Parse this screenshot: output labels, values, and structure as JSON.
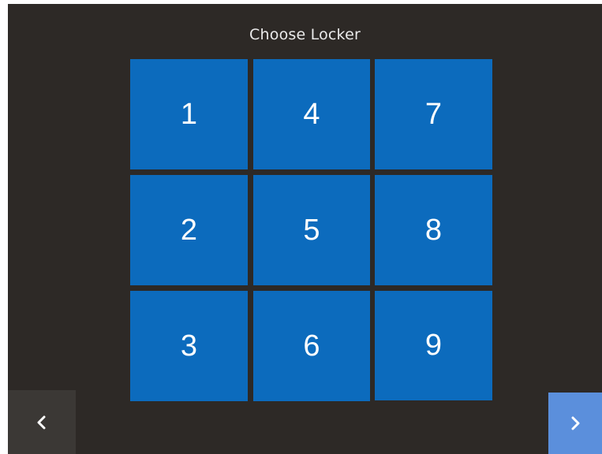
{
  "screen": {
    "title": "Choose Locker"
  },
  "lockers": [
    {
      "number": "1"
    },
    {
      "number": "2"
    },
    {
      "number": "3"
    },
    {
      "number": "4"
    },
    {
      "number": "5"
    },
    {
      "number": "6"
    },
    {
      "number": "7"
    },
    {
      "number": "8"
    },
    {
      "number": "9"
    }
  ],
  "navigation": {
    "previous_icon": "chevron-left-icon",
    "next_icon": "chevron-right-icon"
  },
  "colors": {
    "background": "#2d2926",
    "tile": "#0c6bbd",
    "next_button": "#5b8fdc",
    "previous_button": "#3b3835"
  }
}
